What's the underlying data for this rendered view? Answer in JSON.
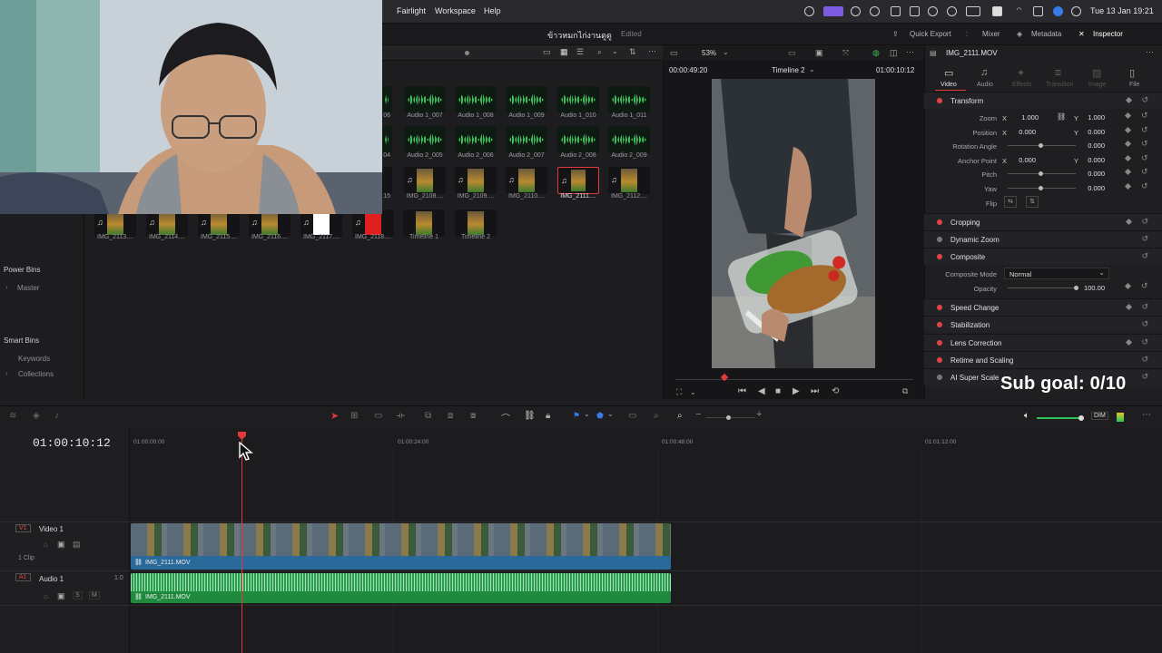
{
  "menubar": {
    "items": [
      "Fairlight",
      "Workspace",
      "Help"
    ],
    "clock": "Tue 13 Jan 19:21"
  },
  "titlebar": {
    "project": "ข้าวหมกไก่งานดูดู",
    "status": "Edited",
    "buttons": [
      "Quick Export",
      "Mixer",
      "Metadata",
      "Inspector"
    ]
  },
  "media_pool": {
    "row1": [
      "Audio 1_007",
      "Audio 1_008",
      "Audio 1_009",
      "Audio 1_010",
      "Audio 1_011"
    ],
    "row1_partial": "06",
    "row2": [
      "Audio 2_005",
      "Audio 2_006",
      "Audio 2_007",
      "Audio 2_008",
      "Audio 2_009"
    ],
    "row2_partial": "04",
    "row3": [
      "IMG_2108....",
      "IMG_2109....",
      "IMG_2110....",
      "IMG_2111....",
      "IMG_2112...."
    ],
    "row3_partial": "15",
    "row4": [
      "IMG_2113....",
      "IMG_2114....",
      "IMG_2115....",
      "IMG_2116....",
      "IMG_2117....",
      "IMG_2118....",
      "Timeline 1",
      "Timeline 2"
    ]
  },
  "bins": {
    "power_bins": "Power Bins",
    "master": "Master",
    "smart_bins": "Smart Bins",
    "keywords": "Keywords",
    "collections": "Collections"
  },
  "viewer": {
    "zoom": "53%",
    "source_tc": "00:00:49:20",
    "timeline_name": "Timeline 2",
    "record_tc": "01:00:10:12"
  },
  "inspector": {
    "clip_name": "IMG_2111.MOV",
    "tabs": [
      "Video",
      "Audio",
      "Effects",
      "Transition",
      "Image",
      "File"
    ],
    "transform_title": "Transform",
    "zoom_label": "Zoom",
    "zoom_x": "1.000",
    "zoom_y": "1.000",
    "position_label": "Position",
    "position_x": "0.000",
    "position_y": "0.000",
    "rotation_label": "Rotation Angle",
    "rotation": "0.000",
    "anchor_label": "Anchor Point",
    "anchor_x": "0.000",
    "anchor_y": "0.000",
    "pitch_label": "Pitch",
    "pitch": "0.000",
    "yaw_label": "Yaw",
    "yaw": "0.000",
    "flip_label": "Flip",
    "x": "X",
    "y": "Y",
    "sections": [
      "Cropping",
      "Dynamic Zoom",
      "Composite",
      "Speed Change",
      "Stabilization",
      "Lens Correction",
      "Retime and Scaling",
      "AI Super Scale"
    ],
    "composite_mode_label": "Composite Mode",
    "composite_mode": "Normal",
    "opacity_label": "Opacity",
    "opacity": "100.00"
  },
  "timeline": {
    "timecode": "01:00:10:12",
    "ruler": [
      "01:00:00:00",
      "01:00:24:00",
      "01:00:48:00",
      "01:01:12:00"
    ],
    "video_track": {
      "id": "V1",
      "name": "Video 1",
      "clips": "1 Clip",
      "clip_name": "IMG_2111.MOV"
    },
    "audio_track": {
      "id": "A1",
      "name": "Audio 1",
      "level": "1.0",
      "clip_name": "IMG_2111.MOV",
      "solo": "S",
      "mute": "M"
    },
    "dim": "DIM"
  },
  "overlay": {
    "subgoal": "Sub goal: 0/10"
  },
  "colors": {
    "accent": "#e23a3a",
    "video_clip": "#2a6a9a",
    "audio_clip": "#1f8a3e"
  }
}
